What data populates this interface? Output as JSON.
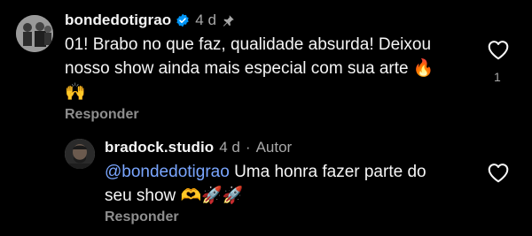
{
  "comments": [
    {
      "username": "bondedotigrao",
      "verified": true,
      "time": "4 d",
      "pinned": true,
      "text_line1": "01! Brabo no que faz, qualidade absurda! Deixou",
      "text_line2": "nosso show ainda mais especial com sua arte 🔥",
      "text_line3": "🙌",
      "reply_label": "Responder",
      "like_count": "1",
      "icons": [
        "avatar",
        "verified-badge-icon",
        "pin-icon",
        "heart-icon"
      ]
    },
    {
      "username": "bradock.studio",
      "time": "4 d",
      "separator": "·",
      "author_label": "Autor",
      "mention": "@bondedotigrao",
      "text_line1_rest": " Uma honra fazer parte do",
      "text_line2": "seu show 🫶🚀🚀",
      "reply_label": "Responder",
      "icons": [
        "avatar",
        "heart-icon"
      ]
    }
  ],
  "colors": {
    "background": "#000000",
    "text": "#f5f5f5",
    "secondary": "#a8a8a8",
    "mention": "#7aa6ff",
    "verified": "#0095f6"
  }
}
